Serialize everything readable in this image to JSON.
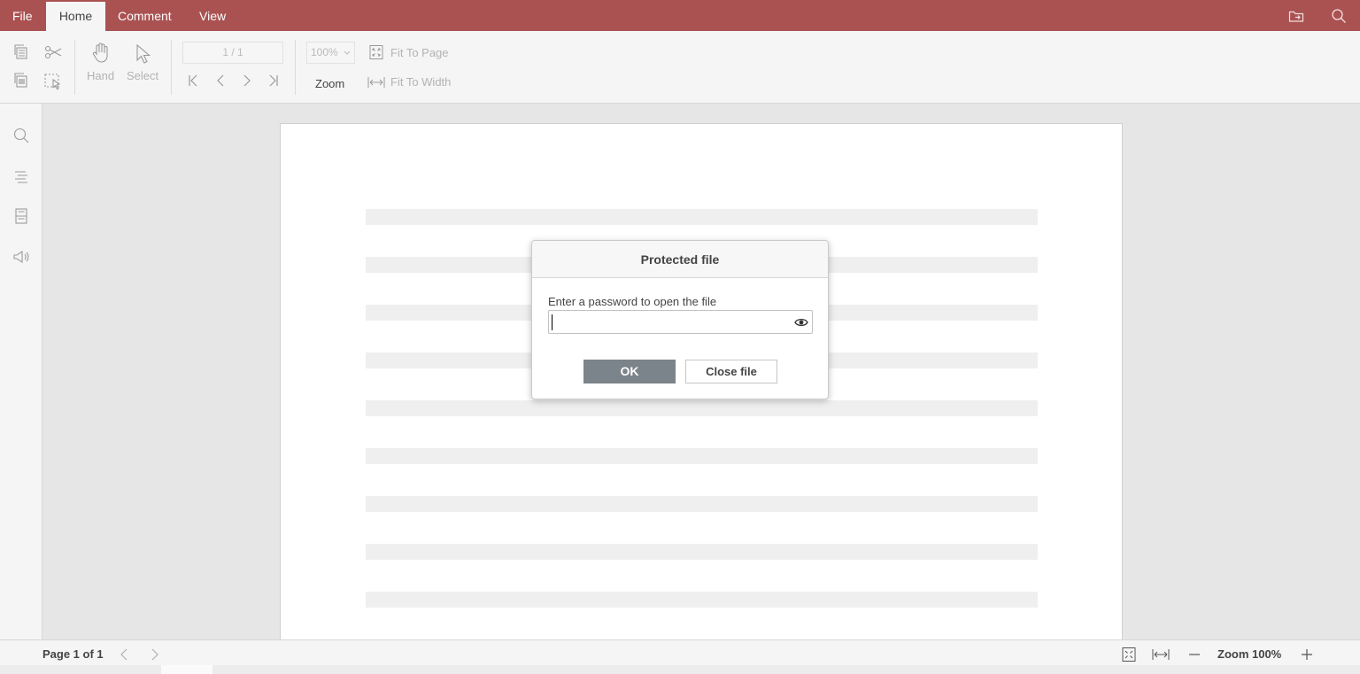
{
  "menu": {
    "tabs": [
      {
        "label": "File"
      },
      {
        "label": "Home"
      },
      {
        "label": "Comment"
      },
      {
        "label": "View"
      }
    ],
    "active_tab": "Home",
    "right_icons": [
      "open-folder-icon",
      "search-icon"
    ]
  },
  "toolbar": {
    "hand_label": "Hand",
    "select_label": "Select",
    "page_value": "1 / 1",
    "zoom_value": "100%",
    "zoom_label": "Zoom",
    "fit_page_label": "Fit To Page",
    "fit_width_label": "Fit To Width"
  },
  "left_panel": {
    "icons": [
      "search-icon",
      "outline-icon",
      "thumbnails-icon",
      "announcement-icon"
    ]
  },
  "dialog": {
    "title": "Protected file",
    "prompt": "Enter a password to open the file",
    "password_value": "",
    "ok_label": "OK",
    "close_label": "Close file"
  },
  "status": {
    "page_text": "Page 1 of 1",
    "zoom_text": "Zoom 100%"
  },
  "colors": {
    "accent": "#aa5252",
    "ok_button": "#7c848b",
    "placeholder_line": "#efefef"
  }
}
